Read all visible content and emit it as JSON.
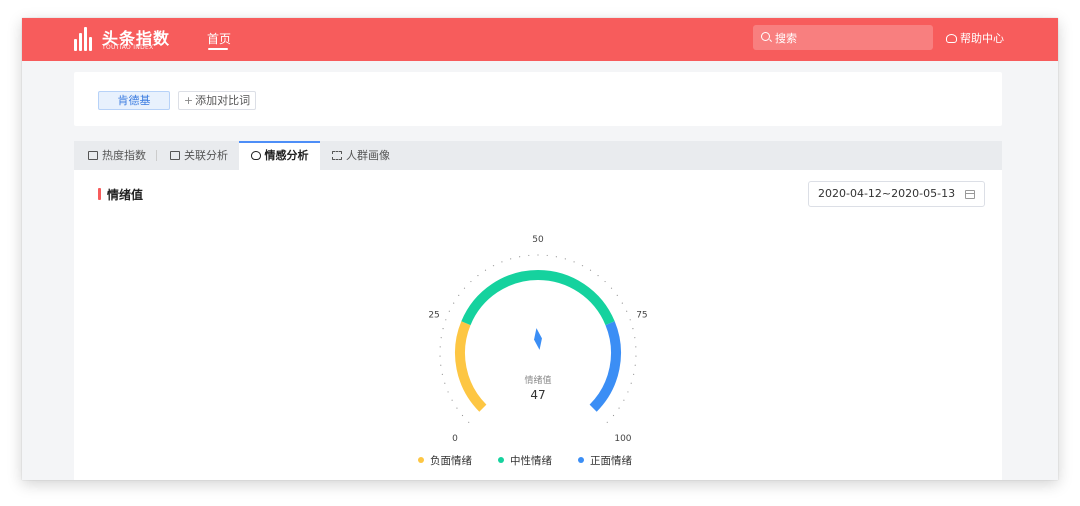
{
  "header": {
    "logo_text": "头条指数",
    "logo_subtext": "TOUTIAO INDEX",
    "nav_home": "首页",
    "search_placeholder": "搜索",
    "help": "帮助中心"
  },
  "compare": {
    "keyword": "肯德基",
    "add_label": "添加对比词"
  },
  "tabs": [
    {
      "label": "热度指数",
      "icon": "heat-chart-icon",
      "active": false
    },
    {
      "label": "关联分析",
      "icon": "image-icon",
      "active": false
    },
    {
      "label": "情感分析",
      "icon": "heart-icon",
      "active": true
    },
    {
      "label": "人群画像",
      "icon": "person-scan-icon",
      "active": false
    }
  ],
  "section": {
    "title": "情绪值",
    "date_range": "2020-04-12~2020-05-13"
  },
  "colors": {
    "brand": "#f75c5c",
    "negative": "#fdc643",
    "neutral": "#15d29e",
    "positive": "#3b8ef5",
    "needle": "#3b8ef5"
  },
  "chart_data": {
    "type": "gauge",
    "min": 0,
    "max": 100,
    "value": 47,
    "center_label": "情绪值",
    "value_label": "47",
    "ticks": [
      "0",
      "25",
      "50",
      "75",
      "100"
    ],
    "bands": [
      {
        "name": "负面情绪",
        "from": 0,
        "to": 25,
        "color": "#fdc643"
      },
      {
        "name": "中性情绪",
        "from": 25,
        "to": 75,
        "color": "#15d29e"
      },
      {
        "name": "正面情绪",
        "from": 75,
        "to": 100,
        "color": "#3b8ef5"
      }
    ],
    "legend": [
      "负面情绪",
      "中性情绪",
      "正面情绪"
    ]
  }
}
